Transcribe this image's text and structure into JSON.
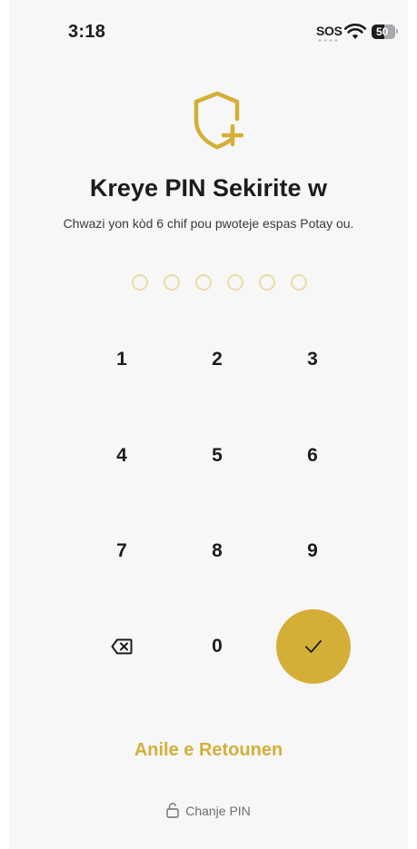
{
  "status_bar": {
    "time": "3:18",
    "sos": "SOS",
    "battery_level": "50"
  },
  "header": {
    "title": "Kreye PIN Sekirite w",
    "subtitle": "Chwazi yon kòd 6 chif pou pwoteje espas Potay ou."
  },
  "pin": {
    "length": 6,
    "filled": 0
  },
  "keypad": {
    "keys": [
      "1",
      "2",
      "3",
      "4",
      "5",
      "6",
      "7",
      "8",
      "9",
      "",
      "0",
      ""
    ]
  },
  "actions": {
    "cancel_label": "Anile e Retounen",
    "change_pin_label": "Chanje PIN"
  },
  "colors": {
    "accent": "#d4af37",
    "dot_outline": "#ecdba4",
    "background": "#f7f7f8"
  },
  "icons": {
    "header": "shield-plus-icon",
    "delete": "backspace-icon",
    "confirm": "checkmark-icon",
    "change_pin": "lock-open-icon"
  }
}
